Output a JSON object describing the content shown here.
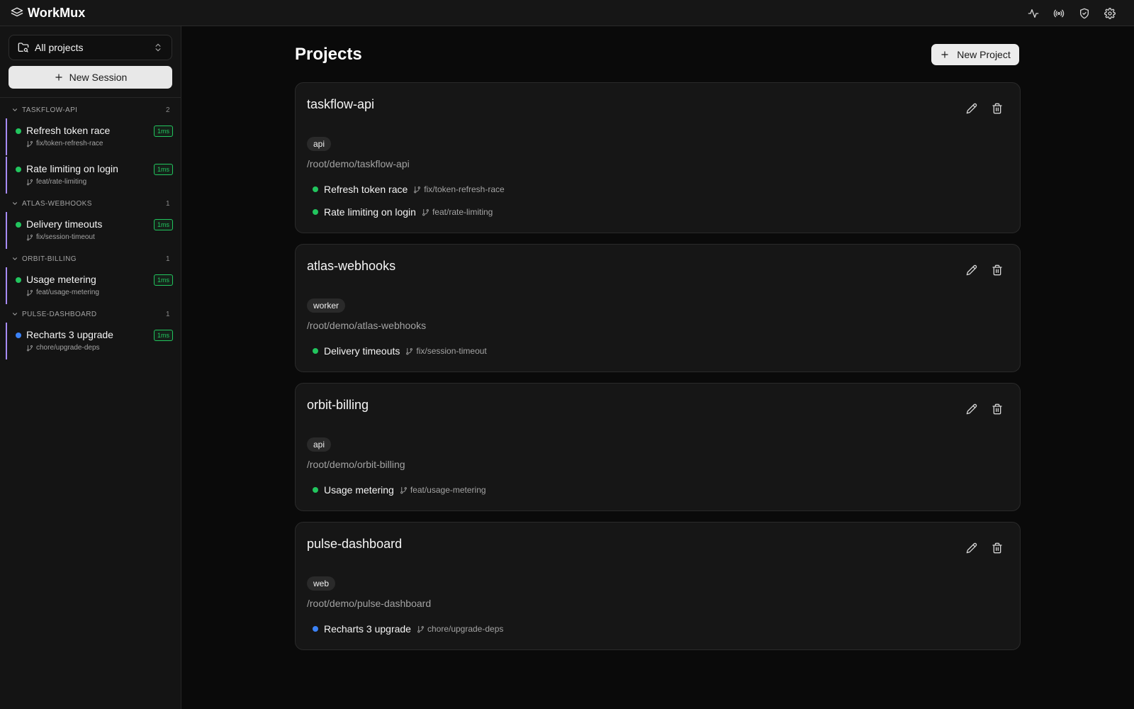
{
  "app": {
    "name": "WorkMux"
  },
  "topbar": {
    "icons": [
      "activity-icon",
      "broadcast-icon",
      "shield-check-icon",
      "settings-icon"
    ]
  },
  "sidebar": {
    "project_select": {
      "label": "All projects"
    },
    "new_session_label": "New Session",
    "groups": [
      {
        "name": "TASKFLOW-API",
        "count": "2",
        "sessions": [
          {
            "title": "Refresh token race",
            "branch": "fix/token-refresh-race",
            "badge": "1ms",
            "status": "green"
          },
          {
            "title": "Rate limiting on login",
            "branch": "feat/rate-limiting",
            "badge": "1ms",
            "status": "green"
          }
        ]
      },
      {
        "name": "ATLAS-WEBHOOKS",
        "count": "1",
        "sessions": [
          {
            "title": "Delivery timeouts",
            "branch": "fix/session-timeout",
            "badge": "1ms",
            "status": "green"
          }
        ]
      },
      {
        "name": "ORBIT-BILLING",
        "count": "1",
        "sessions": [
          {
            "title": "Usage metering",
            "branch": "feat/usage-metering",
            "badge": "1ms",
            "status": "green"
          }
        ]
      },
      {
        "name": "PULSE-DASHBOARD",
        "count": "1",
        "sessions": [
          {
            "title": "Recharts 3 upgrade",
            "branch": "chore/upgrade-deps",
            "badge": "1ms",
            "status": "blue"
          }
        ]
      }
    ]
  },
  "main": {
    "title": "Projects",
    "new_project_label": "New Project",
    "projects": [
      {
        "name": "taskflow-api",
        "tag": "api",
        "path": "/root/demo/taskflow-api",
        "sessions": [
          {
            "title": "Refresh token race",
            "branch": "fix/token-refresh-race",
            "status": "green"
          },
          {
            "title": "Rate limiting on login",
            "branch": "feat/rate-limiting",
            "status": "green"
          }
        ]
      },
      {
        "name": "atlas-webhooks",
        "tag": "worker",
        "path": "/root/demo/atlas-webhooks",
        "sessions": [
          {
            "title": "Delivery timeouts",
            "branch": "fix/session-timeout",
            "status": "green"
          }
        ]
      },
      {
        "name": "orbit-billing",
        "tag": "api",
        "path": "/root/demo/orbit-billing",
        "sessions": [
          {
            "title": "Usage metering",
            "branch": "feat/usage-metering",
            "status": "green"
          }
        ]
      },
      {
        "name": "pulse-dashboard",
        "tag": "web",
        "path": "/root/demo/pulse-dashboard",
        "sessions": [
          {
            "title": "Recharts 3 upgrade",
            "branch": "chore/upgrade-deps",
            "status": "blue"
          }
        ]
      }
    ]
  },
  "colors": {
    "accent_purple": "#a78bfa",
    "status_green": "#22c55e",
    "status_blue": "#3b82f6",
    "background": "#0a0a0a",
    "surface": "#161616"
  }
}
